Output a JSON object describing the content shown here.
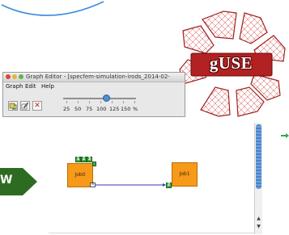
{
  "logo": {
    "text": "gUSE",
    "color": "#b22222"
  },
  "window": {
    "title": "Graph Editor - [specfem-simulation-irods_2014-02-",
    "menu": [
      "Graph",
      "Edit",
      "Help"
    ],
    "toolbar": {
      "buttons": [
        {
          "icon": "new-graph-icon"
        },
        {
          "icon": "edit-graph-icon"
        },
        {
          "icon": "delete-icon",
          "glyph": "✕"
        }
      ],
      "zoom_labels": [
        "25",
        "50",
        "75",
        "100",
        "125",
        "150",
        "%"
      ],
      "zoom_value_percent": 100
    }
  },
  "arrow": {
    "text": "W",
    "color": "#2e6b22"
  },
  "graph": {
    "jobs": [
      {
        "label": "Job0",
        "input_ports": [
          "1",
          "2",
          "3"
        ],
        "output_port": "4"
      },
      {
        "label": "Job1",
        "input_ports": [
          "2"
        ]
      }
    ],
    "edge_color": "#3a3aaa"
  },
  "scrollbar": {
    "up": "▲",
    "down": "▼"
  },
  "colors": {
    "job": "#f79a1a",
    "port": "#4aa84a",
    "scroll_thumb": "#5a92d6"
  }
}
